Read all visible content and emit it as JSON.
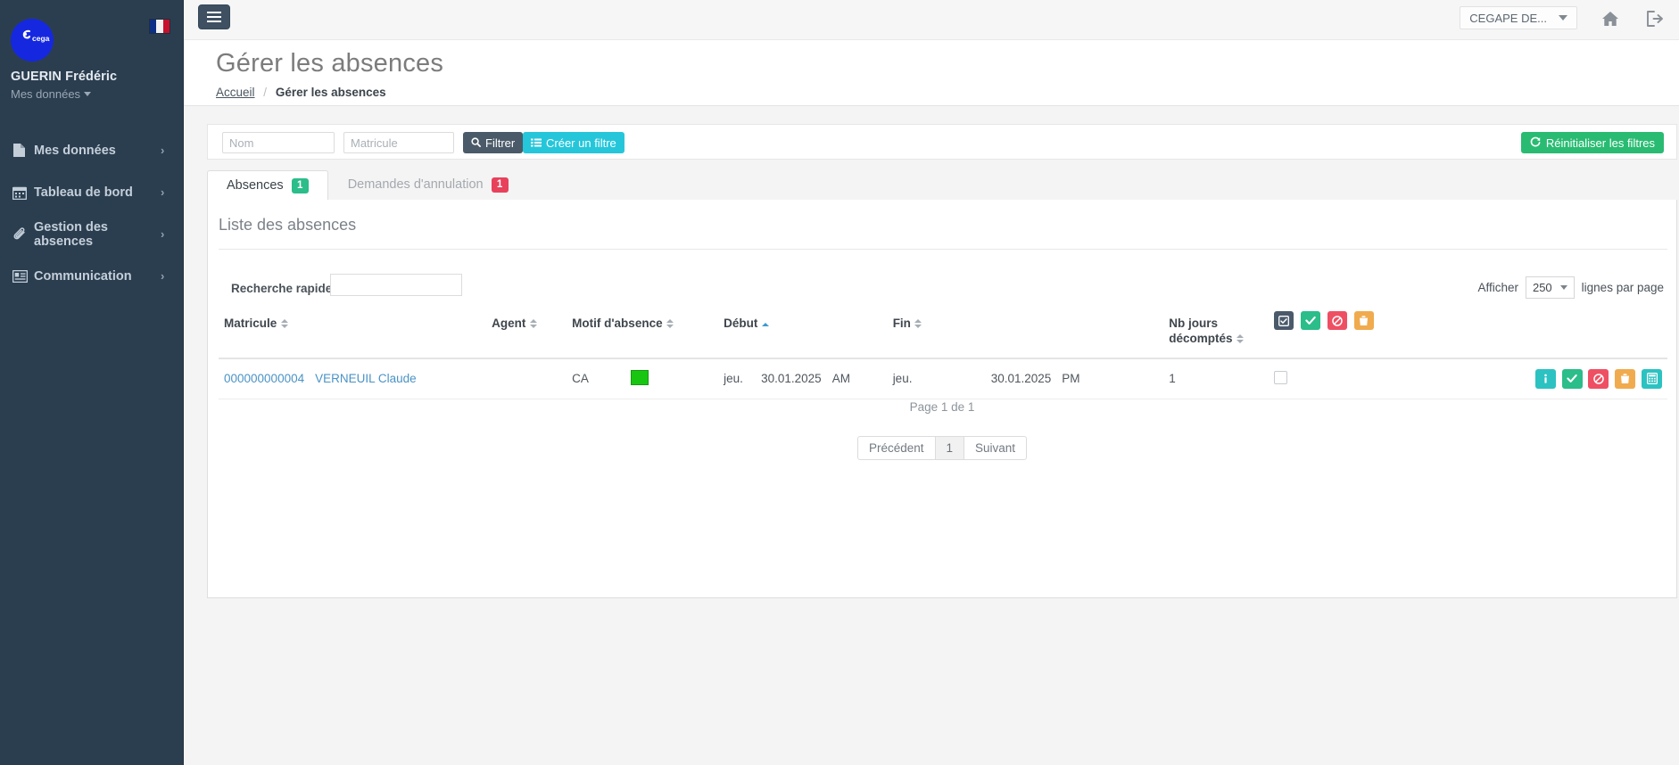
{
  "sidebar": {
    "brand_logo": "cegape-logo",
    "flag": "french-flag-icon",
    "user_name": "GUERIN Frédéric",
    "user_menu_label": "Mes données",
    "items": [
      {
        "label": "Mes données",
        "icon": "file-icon"
      },
      {
        "label": "Tableau de bord",
        "icon": "calendar-icon"
      },
      {
        "label": "Gestion des absences",
        "icon": "paperclip-icon"
      },
      {
        "label": "Communication",
        "icon": "id-card-icon"
      }
    ]
  },
  "topbar": {
    "menu_toggle": "hamburger-icon",
    "org_label": "CEGAPE DE...",
    "home_icon": "home-icon",
    "logout_icon": "logout-icon"
  },
  "header": {
    "title": "Gérer les absences",
    "breadcrumb_home": "Accueil",
    "breadcrumb_separator": "/",
    "breadcrumb_current": "Gérer les absences"
  },
  "filters": {
    "nom_placeholder": "Nom",
    "nom_value": "",
    "matricule_placeholder": "Matricule",
    "matricule_value": "",
    "filtrer_label": "Filtrer",
    "creer_filtre_label": "Créer un filtre",
    "reset_label": "Réinitialiser les filtres"
  },
  "tabs": [
    {
      "label": "Absences",
      "badge": "1",
      "badge_color": "#2bbd8a",
      "active": true
    },
    {
      "label": "Demandes d'annulation",
      "badge": "1",
      "badge_color": "#e8415c",
      "active": false
    }
  ],
  "list": {
    "title": "Liste des absences",
    "quick_search_label": "Recherche rapide",
    "quick_search_value": "",
    "per_page_prefix": "Afficher",
    "per_page_value": "250",
    "per_page_suffix": "lignes par page",
    "columns": {
      "matricule": "Matricule",
      "agent": "Agent",
      "motif": "Motif d'absence",
      "debut": "Début",
      "fin": "Fin",
      "nb_jours": "Nb jours décomptés"
    },
    "header_actions": [
      {
        "name": "select-all-button",
        "icon": "check-square-icon",
        "color": "dark"
      },
      {
        "name": "validate-all-button",
        "icon": "check-icon",
        "color": "green"
      },
      {
        "name": "refuse-all-button",
        "icon": "ban-icon",
        "color": "red"
      },
      {
        "name": "delete-all-button",
        "icon": "trash-icon",
        "color": "orange"
      }
    ],
    "rows": [
      {
        "matricule": "000000000004",
        "agent": "VERNEUIL Claude",
        "motif_code": "CA",
        "motif_color": "#18c612",
        "debut_day": "jeu.",
        "debut_date": "30.01.2025",
        "debut_period": "AM",
        "fin_day": "jeu.",
        "fin_date": "30.01.2025",
        "fin_period": "PM",
        "nb_jours": "1",
        "actions": [
          {
            "name": "info-button",
            "icon": "info-icon",
            "color": "teal"
          },
          {
            "name": "validate-button",
            "icon": "check-icon",
            "color": "green"
          },
          {
            "name": "refuse-button",
            "icon": "ban-icon",
            "color": "red"
          },
          {
            "name": "delete-button",
            "icon": "trash-icon",
            "color": "orange"
          },
          {
            "name": "calculate-button",
            "icon": "calculator-icon",
            "color": "teal"
          }
        ]
      }
    ],
    "page_info": "Page 1 de 1",
    "pager": {
      "prev": "Précédent",
      "current": "1",
      "next": "Suivant"
    }
  }
}
